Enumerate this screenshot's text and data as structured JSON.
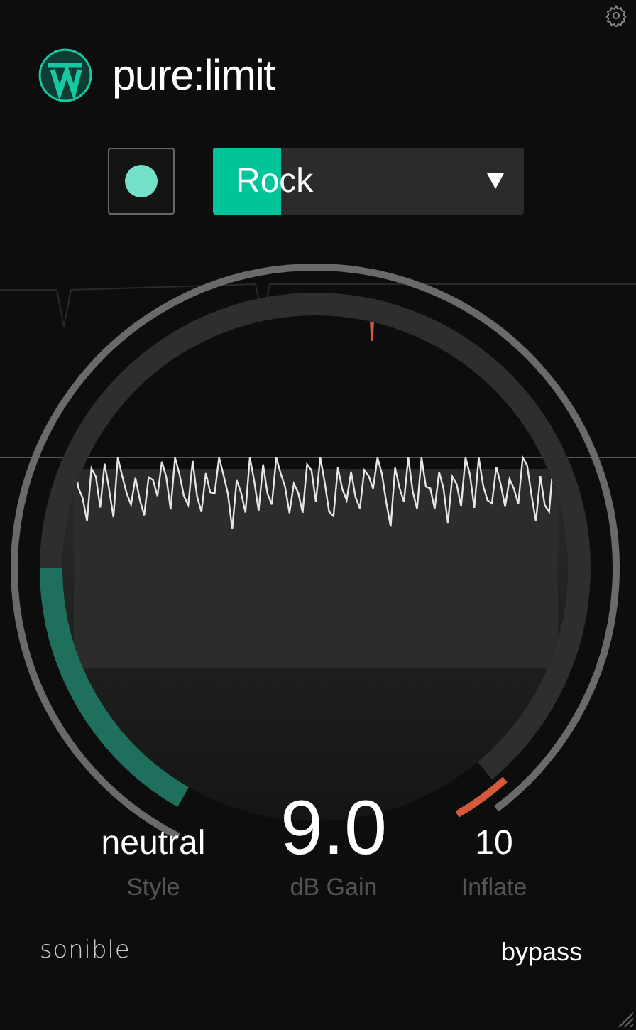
{
  "header": {
    "title": "pure:limit"
  },
  "learn_button": {
    "on": true
  },
  "preset": {
    "name": "Rock",
    "level": 0.22
  },
  "controls": [
    {
      "kind": "small",
      "value": "neutral",
      "label": "Style"
    },
    {
      "kind": "main",
      "value": "9.0",
      "label": "dB Gain"
    },
    {
      "kind": "small",
      "value": "10",
      "label": "Inflate"
    }
  ],
  "footer": {
    "brand": "sonible",
    "bypass": "bypass"
  }
}
